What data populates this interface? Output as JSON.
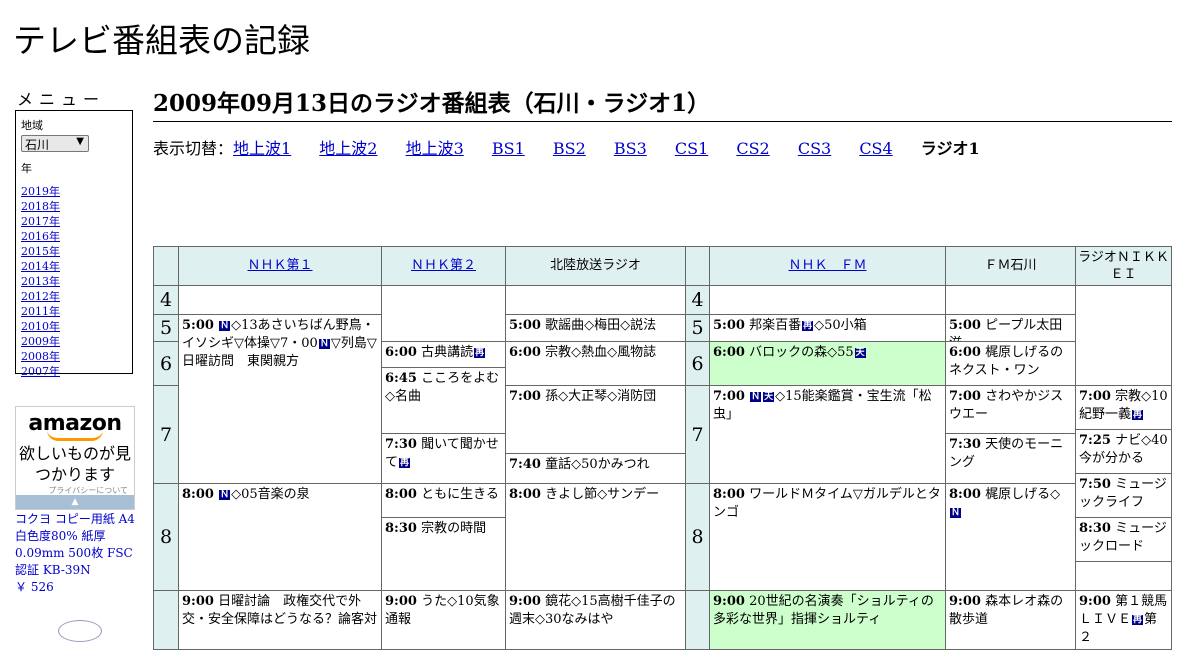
{
  "site_title": "テレビ番組表の記録",
  "menu": {
    "heading": "メニュー",
    "region_label": "地域",
    "region_value": "石川",
    "year_label": "年",
    "years": [
      "2019年",
      "2018年",
      "2017年",
      "2016年",
      "2015年",
      "2014年",
      "2013年",
      "2012年",
      "2011年",
      "2010年",
      "2009年",
      "2008年",
      "2007年"
    ]
  },
  "ad": {
    "logo": "amazon",
    "copy": "欲しいものが見つかります",
    "privacy": "プライバシーについて",
    "product": "コクヨ コピー用紙 A4 白色度80% 紙厚0.09mm 500枚 FSC認証 KB-39N",
    "price": "￥ 526"
  },
  "page_title": "2009年09月13日のラジオ番組表（石川・ラジオ1）",
  "switcher": {
    "label": "表示切替：",
    "links": [
      "地上波1",
      "地上波2",
      "地上波3",
      "BS1",
      "BS2",
      "BS3",
      "CS1",
      "CS2",
      "CS3",
      "CS4"
    ],
    "current": "ラジオ1"
  },
  "grid": {
    "stations": [
      "ＮＨＫ第１",
      "ＮＨＫ第２",
      "北陸放送ラジオ",
      "ＮＨＫ　ＦＭ",
      "ＦＭ石川",
      "ラジオＮＩＫＫＥＩ"
    ],
    "hours": [
      "4",
      "5",
      "6",
      "7",
      "8",
      "9"
    ],
    "programs": [
      {
        "time": "5:00",
        "title": "◇13あさいちばん野鳥・イソシギ▽体操▽7・00",
        "title2": "▽列島▽日曜訪問　東関親方"
      },
      {
        "time": "8:00",
        "title": "◇05音楽の泉"
      },
      {
        "time": "9:00",
        "title": "日曜討論　政権交代で外交・安全保障はどうなる？論客対"
      },
      {
        "time": "6:00",
        "title": "古典講読"
      },
      {
        "time": "6:45",
        "title": "こころをよむ◇名曲"
      },
      {
        "time": "7:30",
        "title": "聞いて聞かせて"
      },
      {
        "time": "8:00",
        "title": "ともに生きる"
      },
      {
        "time": "8:30",
        "title": "宗教の時間"
      },
      {
        "time": "9:00",
        "title": "うた◇10気象通報"
      },
      {
        "time": "5:00",
        "title": "歌謡曲◇梅田◇説法"
      },
      {
        "time": "6:00",
        "title": "宗教◇熱血◇風物誌"
      },
      {
        "time": "7:00",
        "title": "孫◇大正琴◇消防団"
      },
      {
        "time": "7:40",
        "title": "童話◇50かみつれ"
      },
      {
        "time": "8:00",
        "title": "きよし節◇サンデー"
      },
      {
        "time": "9:00",
        "title": "鏡花◇15高樹千佳子の週末◇30なみはや"
      },
      {
        "time": "5:00",
        "title": "邦楽百番",
        "title2": "◇50小箱"
      },
      {
        "time": "6:00",
        "title": "バロックの森◇55"
      },
      {
        "time": "7:00",
        "title": "◇15能楽鑑賞・宝生流「松虫」"
      },
      {
        "time": "8:00",
        "title": "ワールドＭタイム▽ガルデルとタンゴ"
      },
      {
        "time": "9:00",
        "title": "20世紀の名演奏「ショルティの多彩な世界」指揮ショルティ"
      },
      {
        "time": "5:00",
        "title": "ピープル太田滋"
      },
      {
        "time": "6:00",
        "title": "梶原しげるのネクスト・ワン"
      },
      {
        "time": "7:00",
        "title": "さわやかジスウエー"
      },
      {
        "time": "7:30",
        "title": "天使のモーニング"
      },
      {
        "time": "8:00",
        "title": "梶原しげる◇"
      },
      {
        "time": "9:00",
        "title": "森本レオ森の散歩道"
      },
      {
        "time": "7:00",
        "title": "宗教◇10紀野一義"
      },
      {
        "time": "7:25",
        "title": "ナビ◇40今が分かる"
      },
      {
        "time": "7:50",
        "title": "ミュージックライフ"
      },
      {
        "time": "8:30",
        "title": "ミュージックロード"
      },
      {
        "time": "9:00",
        "title": "第１競馬ＬＩＶＥ",
        "title2": "第２"
      }
    ]
  },
  "icons": {
    "news": "Ｎ",
    "weather": "天",
    "rerun": "再"
  }
}
